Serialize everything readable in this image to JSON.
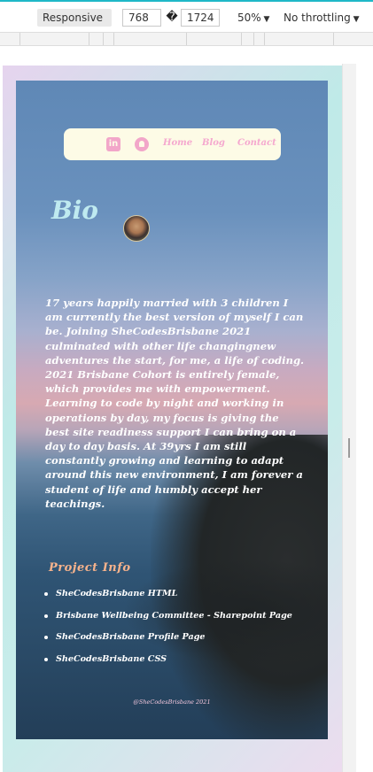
{
  "devtools": {
    "device_mode": "Responsive",
    "width_value": "768",
    "separator": "�",
    "height_value": "1724",
    "zoom": "50%",
    "throttling": "No throttling"
  },
  "nav": {
    "icons": [
      "linkedin-icon",
      "github-icon"
    ],
    "linkedin_glyph": "in",
    "links": [
      "Home",
      "Blog",
      "Contact"
    ]
  },
  "bio": {
    "title": "Bio",
    "text": "17 years happily married with 3 children I am currently the best version of myself I can be. Joining SheCodesBrisbane 2021 culminated with other life changingnew adventures the start, for me, a life of coding. 2021 Brisbane Cohort is entirely female, which provides me with empowerment. Learning to code by night and working in operations by day, my focus is giving the best site readiness support I can bring on a day to day basis. At 39yrs I am still constantly growing and learning to adapt around this new environment, I am forever a student of life and humbly accept her teachings."
  },
  "projects": {
    "title": "Project Info",
    "items": [
      "SheCodesBrisbane HTML",
      "Brisbane Wellbeing Committee - Sharepoint Page",
      "SheCodesBrisbane Profile Page",
      "SheCodesBrisbane CSS"
    ]
  },
  "footer": {
    "text": "@SheCodesBrisbane 2021"
  },
  "colors": {
    "accent_pink": "#f5a8cf",
    "nav_bg": "#fdfbe6",
    "bio_title": "#bfeaf0",
    "project_title": "#f7b38c",
    "devtools_accent": "#1fb8c7"
  }
}
